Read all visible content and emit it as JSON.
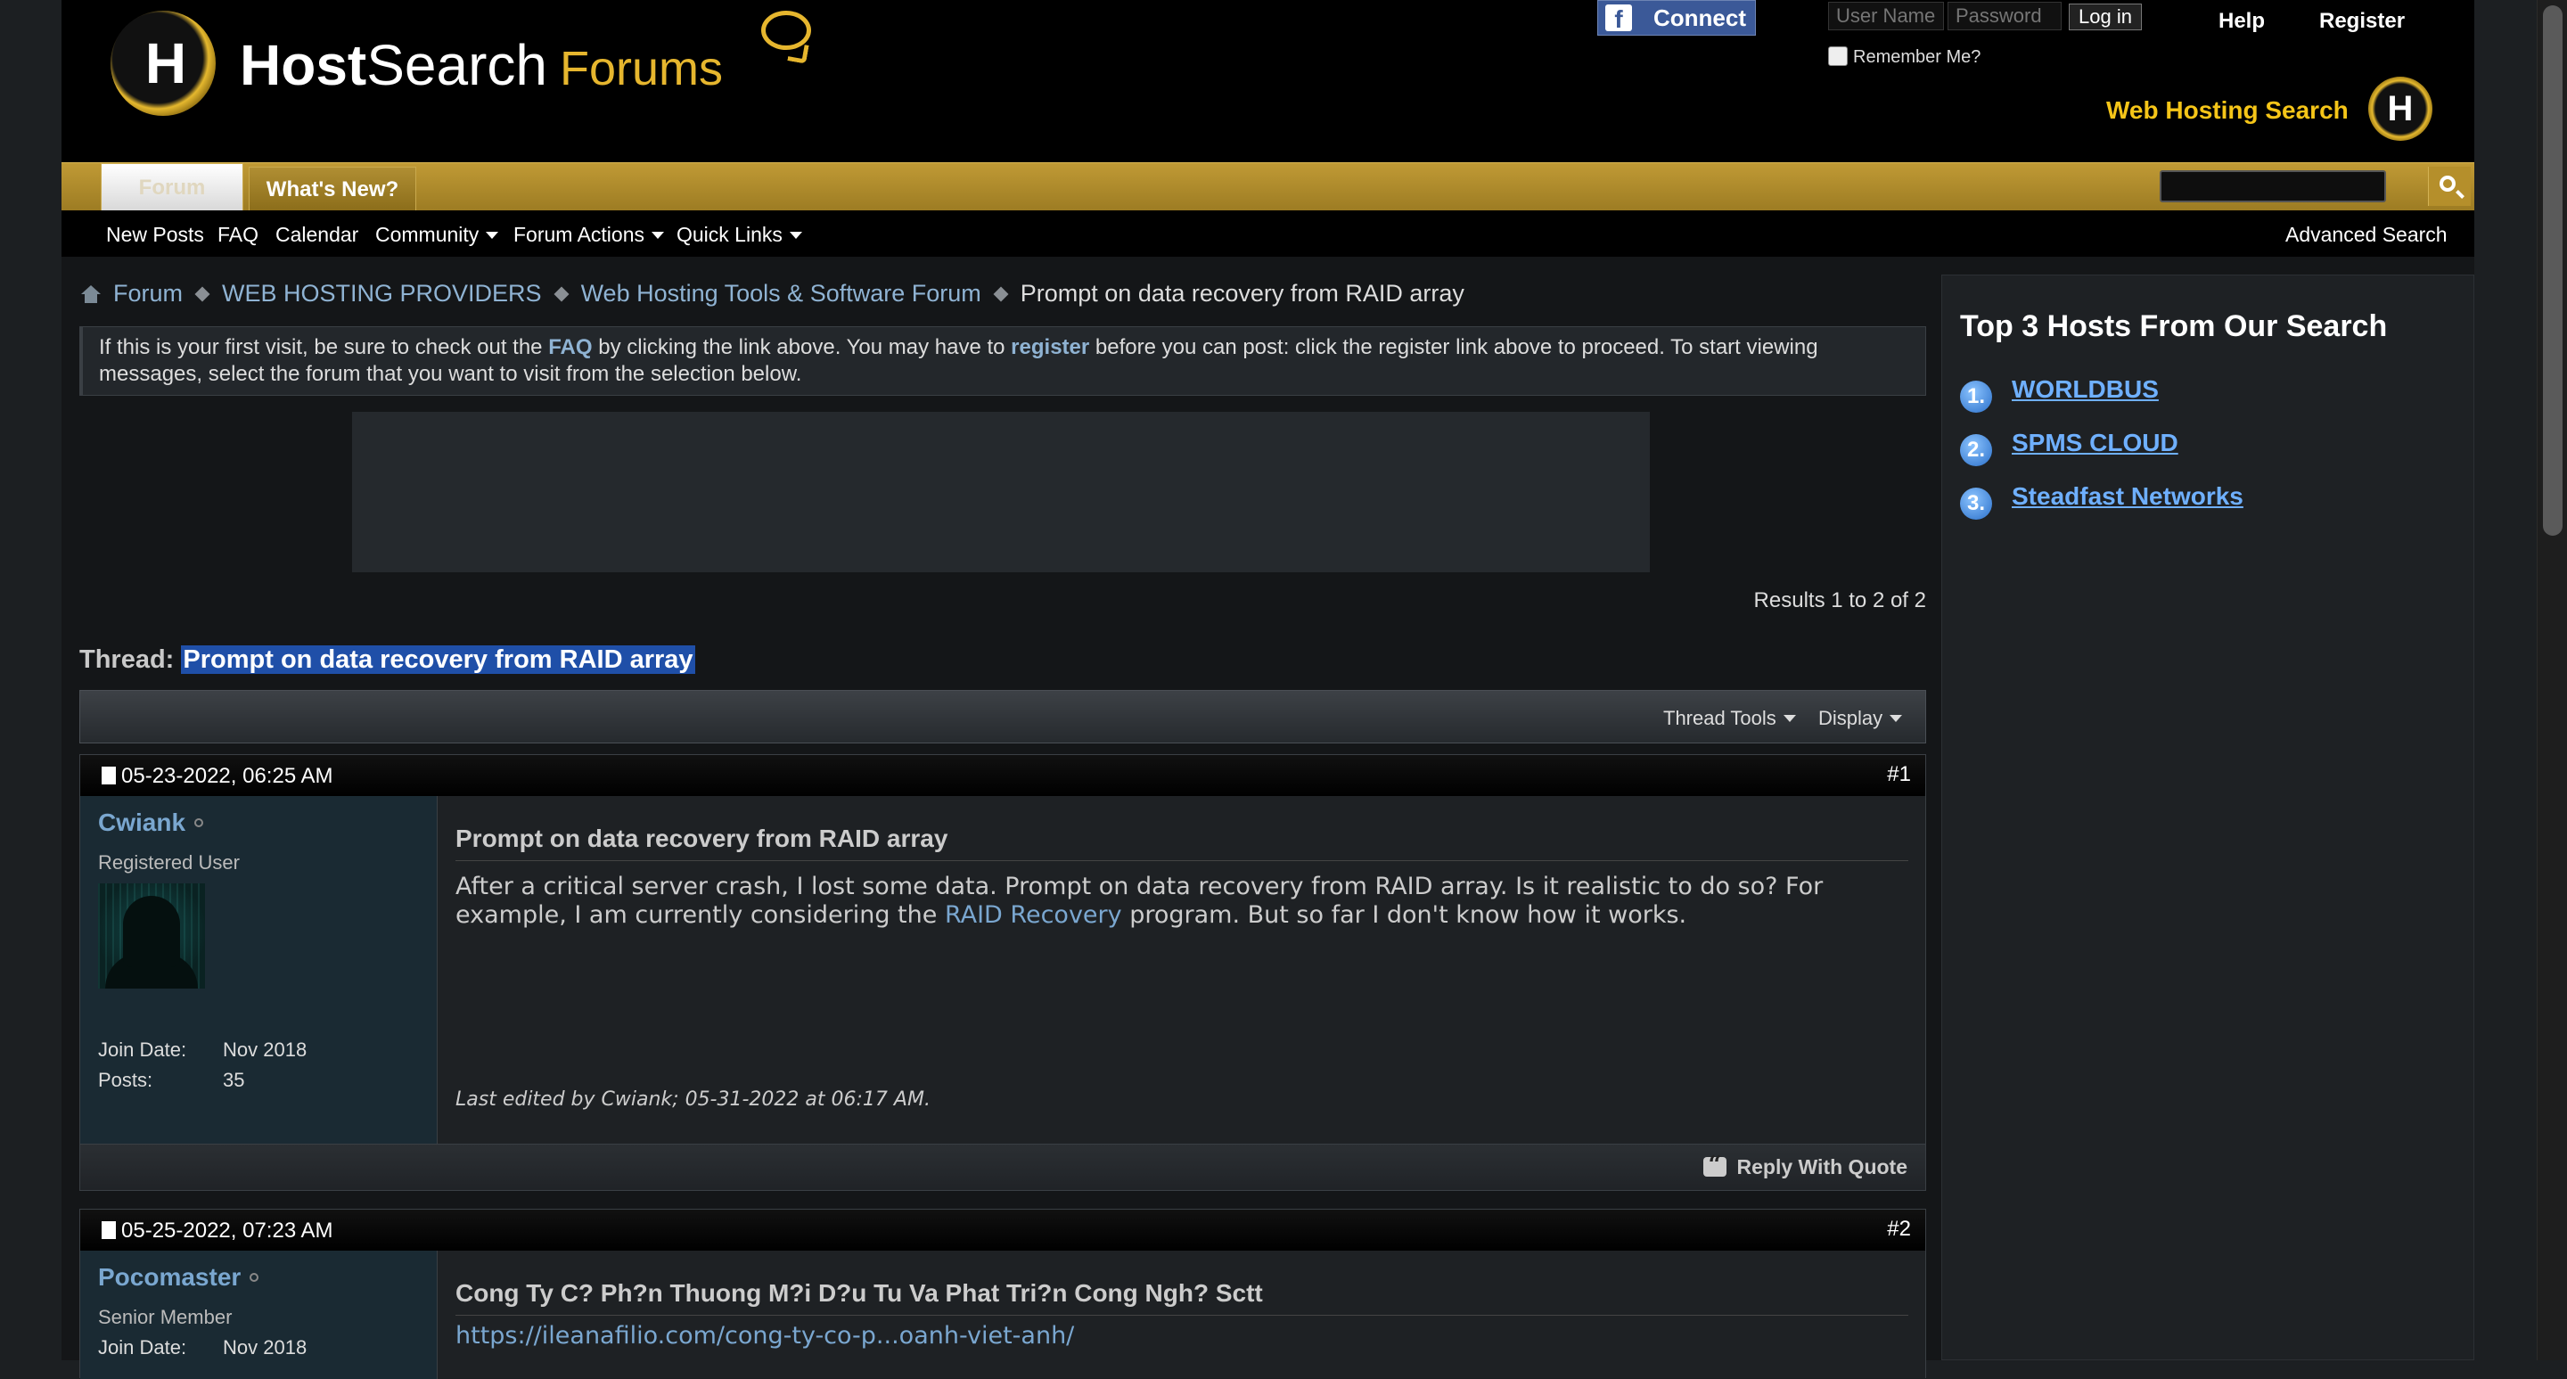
{
  "header": {
    "logo_text_bold": "Host",
    "logo_text_thin": "Search",
    "logo_text_gold": "Forums",
    "logo_letter": "H",
    "fb_connect": "Connect",
    "fb_letter": "f",
    "username_placeholder": "User Name",
    "password_placeholder": "Password",
    "login_button": "Log in",
    "remember_me": "Remember Me?",
    "help": "Help",
    "register": "Register",
    "tagline": "Web Hosting Search",
    "tagline_logo_letter": "H"
  },
  "navbar": {
    "tabs": [
      {
        "label": "Forum"
      },
      {
        "label": "What's New?"
      }
    ]
  },
  "subnav": {
    "links": [
      "New Posts",
      "FAQ",
      "Calendar",
      "Community",
      "Forum Actions",
      "Quick Links"
    ],
    "advanced_search": "Advanced Search"
  },
  "breadcrumb": {
    "items": [
      "Forum",
      "WEB HOSTING PROVIDERS",
      "Web Hosting Tools & Software Forum"
    ],
    "current": "Prompt on data recovery from RAID array"
  },
  "notice": {
    "part1": "If this is your first visit, be sure to check out the ",
    "faq": "FAQ",
    "part2": " by clicking the link above. You may have to ",
    "register": "register",
    "part3": " before you can post: click the register link above to proceed. To start viewing messages, select the forum that you want to visit from the selection below."
  },
  "results": "Results 1 to 2 of 2",
  "thread": {
    "label": "Thread: ",
    "title": "Prompt on data recovery from RAID array",
    "tools": "Thread Tools",
    "display": "Display"
  },
  "posts": [
    {
      "date": "05-23-2022, 06:25 AM",
      "number": "#1",
      "username": "Cwiank",
      "user_title": "Registered User",
      "join_label": "Join Date:",
      "join_date": "Nov 2018",
      "posts_label": "Posts:",
      "post_count": "35",
      "title": "Prompt on data recovery from RAID array",
      "body_part1": "After a critical server crash, I lost some data. Prompt on data recovery from RAID array. Is it realistic to do so? For example, I am currently considering the ",
      "body_link": "RAID Recovery",
      "body_part2": " program. But so far I don't know how it works.",
      "edited": "Last edited by Cwiank; 05-31-2022 at 06:17 AM.",
      "reply": "Reply With Quote"
    },
    {
      "date": "05-25-2022, 07:23 AM",
      "number": "#2",
      "username": "Pocomaster",
      "user_title": "Senior Member",
      "join_label": "Join Date:",
      "join_date": "Nov 2018",
      "title": "Cong Ty C? Ph?n Thuong M?i D?u Tu Va Phat Tri?n Cong Ngh? Sctt",
      "body_link": "https://ileanafilio.com/cong-ty-co-p...oanh-viet-anh/"
    }
  ],
  "sidebar": {
    "title": "Top 3 Hosts From Our Search",
    "hosts": [
      {
        "rank": "1.",
        "name": "WORLDBUS"
      },
      {
        "rank": "2.",
        "name": "SPMS CLOUD"
      },
      {
        "rank": "3.",
        "name": "Steadfast Networks"
      }
    ]
  }
}
